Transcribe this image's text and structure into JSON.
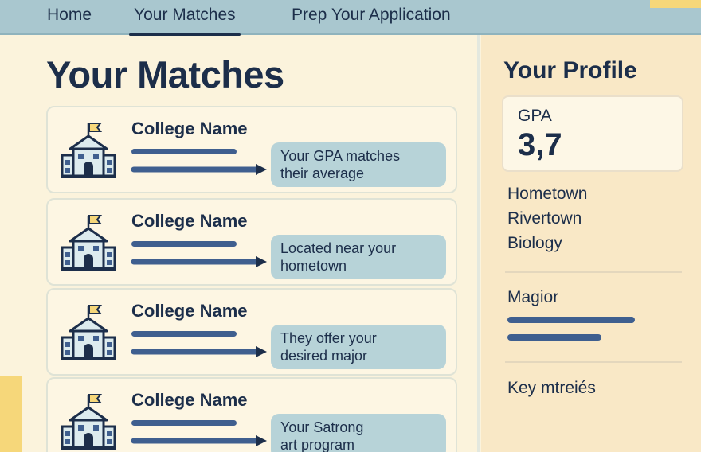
{
  "nav": {
    "items": [
      {
        "label": "Home"
      },
      {
        "label": "Your Matches",
        "active": true
      },
      {
        "label": "Prep Your Application"
      }
    ]
  },
  "main": {
    "title": "Your Matches",
    "cards": [
      {
        "name": "College Name",
        "reason_line1": "Your GPA matches",
        "reason_line2": "their average",
        "icon": "school-building-icon"
      },
      {
        "name": "College Name",
        "reason_line1": "Located near your",
        "reason_line2": "hometown",
        "icon": "school-building-icon"
      },
      {
        "name": "College Name",
        "reason_line1": "They offer your",
        "reason_line2": "desired major",
        "icon": "school-building-icon"
      },
      {
        "name": "College Name",
        "reason_line1": "Your Satrong",
        "reason_line2": "art program",
        "icon": "school-building-icon"
      }
    ]
  },
  "profile": {
    "title": "Your Profile",
    "gpa_label": "GPA",
    "gpa_value": "3,7",
    "details": [
      "Hometown",
      "Rivertown",
      "Biology"
    ],
    "major_label": "Magior",
    "metrics_label": "Key mtreiés"
  },
  "colors": {
    "nav_bg": "#a9c7cf",
    "page_bg": "#fbf3dc",
    "sidebar_bg": "#f9e8c6",
    "accent_yellow": "#f6d77a",
    "navy": "#1c2e4a",
    "line_blue": "#3f5f8f",
    "reason_bubble": "#b7d3d8"
  }
}
